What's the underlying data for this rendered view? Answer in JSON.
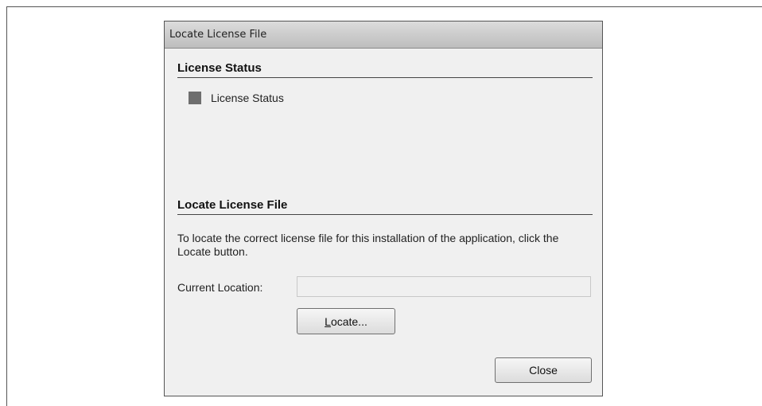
{
  "dialog": {
    "title": "Locate License File"
  },
  "license_status": {
    "header": "License Status",
    "item_label": "License Status",
    "item_color": "#6e6e6e"
  },
  "locate": {
    "header": "Locate License File",
    "description": "To locate the correct license file for this installation of the application, click the Locate button.",
    "location_label": "Current Location:",
    "location_value": "",
    "locate_button_mnemonic": "L",
    "locate_button_rest": "ocate...",
    "close_button": "Close"
  }
}
